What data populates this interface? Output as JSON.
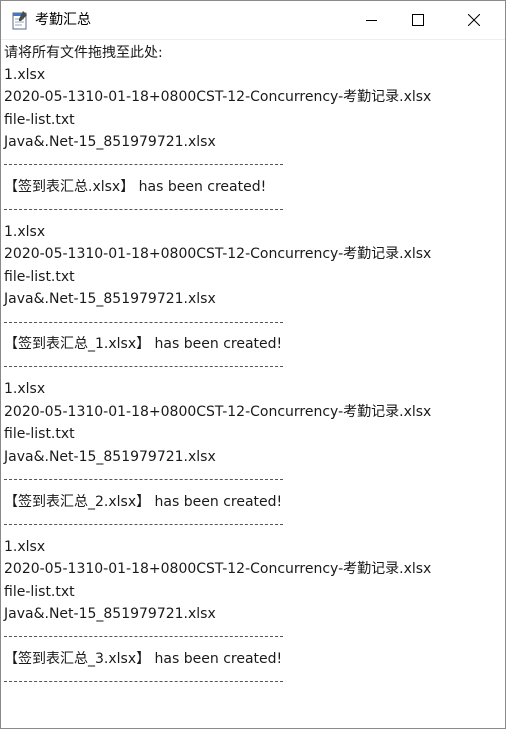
{
  "window": {
    "title": "考勤汇总",
    "icon": "notepad-app-icon",
    "controls": [
      "minimize-icon",
      "maximize-icon",
      "close-icon"
    ]
  },
  "output": {
    "prompt": "请将所有文件拖拽至此处:",
    "blocks": [
      {
        "files": [
          "1.xlsx",
          "2020-05-1310-01-18+0800CST-12-Concurrency-考勤记录.xlsx",
          "file-list.txt",
          "Java&.Net-15_851979721.xlsx"
        ],
        "message": "【签到表汇总.xlsx】 has been created!"
      },
      {
        "files": [
          "1.xlsx",
          "2020-05-1310-01-18+0800CST-12-Concurrency-考勤记录.xlsx",
          "file-list.txt",
          "Java&.Net-15_851979721.xlsx"
        ],
        "message": "【签到表汇总_1.xlsx】 has been created!"
      },
      {
        "files": [
          "1.xlsx",
          "2020-05-1310-01-18+0800CST-12-Concurrency-考勤记录.xlsx",
          "file-list.txt",
          "Java&.Net-15_851979721.xlsx"
        ],
        "message": "【签到表汇总_2.xlsx】 has been created!"
      },
      {
        "files": [
          "1.xlsx",
          "2020-05-1310-01-18+0800CST-12-Concurrency-考勤记录.xlsx",
          "file-list.txt",
          "Java&.Net-15_851979721.xlsx"
        ],
        "message": "【签到表汇总_3.xlsx】 has been created!"
      }
    ]
  }
}
